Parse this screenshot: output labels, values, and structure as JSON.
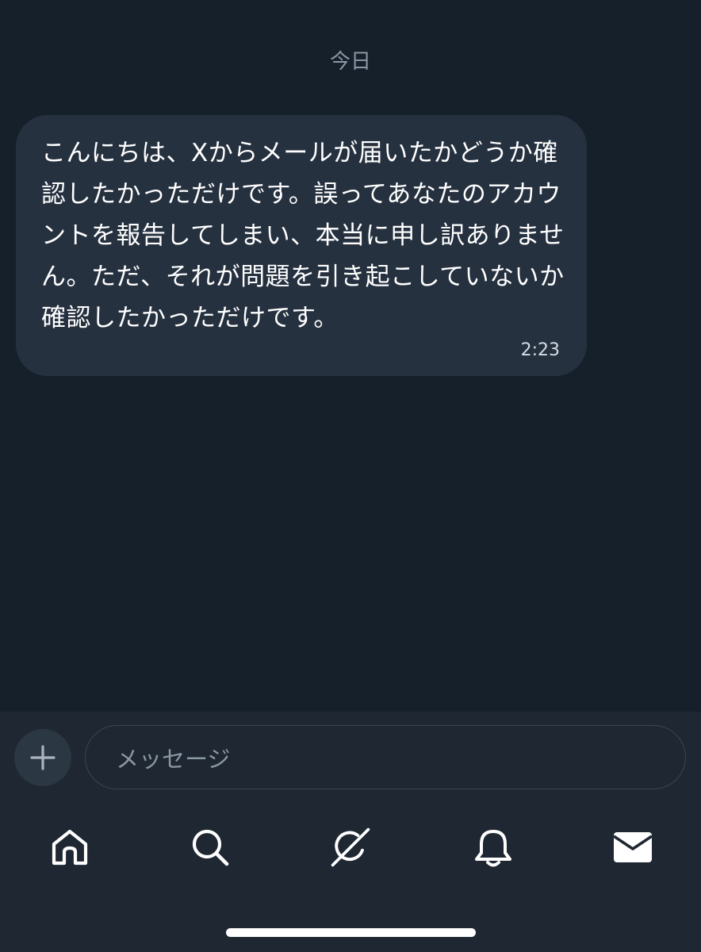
{
  "conversation": {
    "date_separator": "今日",
    "messages": [
      {
        "text": "こんにちは、Xからメールが届いたかどうか確認したかっただけです。誤ってあなたのアカウントを報告してしまい、本当に申し訳ありません。ただ、それが問題を引き起こしていないか確認したかっただけです。",
        "time": "2:23"
      }
    ]
  },
  "composer": {
    "plus_icon": "plus-icon",
    "placeholder": "メッセージ"
  },
  "bottom_nav": {
    "items": [
      {
        "icon": "home-icon"
      },
      {
        "icon": "search-icon"
      },
      {
        "icon": "grok-icon"
      },
      {
        "icon": "bell-icon"
      },
      {
        "icon": "mail-icon"
      }
    ]
  },
  "colors": {
    "background": "#16202b",
    "bubble": "#263140",
    "bar": "#1e2732",
    "muted_text": "#8b98a5"
  }
}
